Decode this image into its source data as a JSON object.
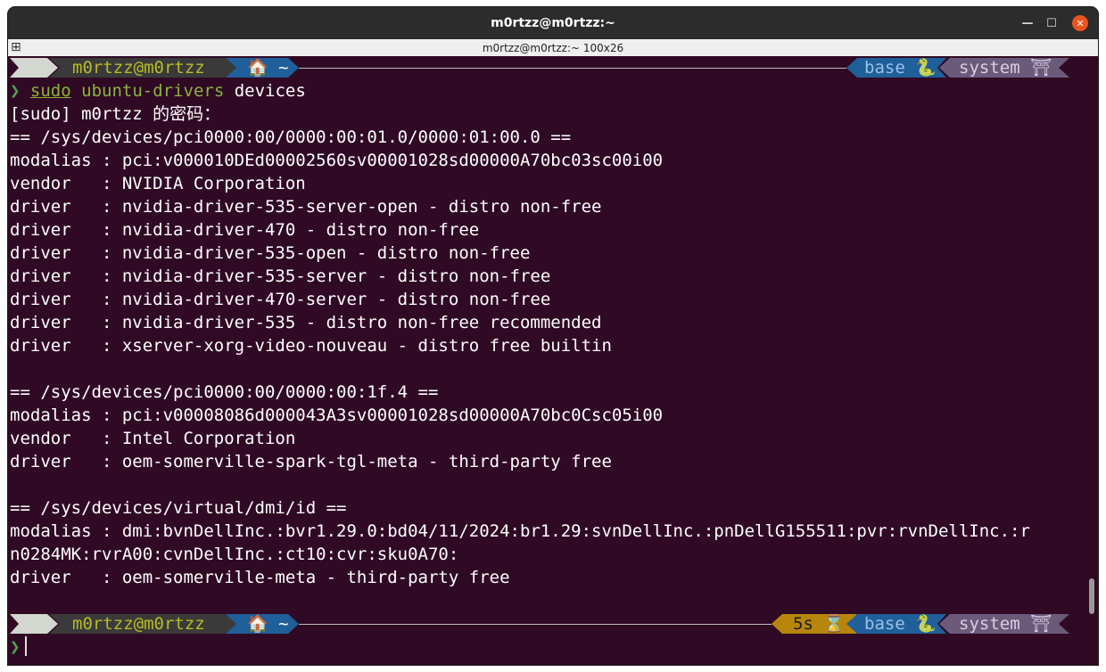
{
  "window": {
    "title": "m0rtzz@m0rtzz:~",
    "tab_title": "m0rtzz@m0rtzz:~ 100x26",
    "close_glyph": "✕",
    "min_glyph": "—",
    "max_glyph": "☐"
  },
  "prompt": {
    "os_icon": "",
    "context": "m0rtzz@m0rtzz",
    "dir": "🏠 ~",
    "time": "5s ⌛",
    "conda": "base 🐍",
    "system": "system ⛩",
    "prompt_char": "❯"
  },
  "command": {
    "sudo": "sudo",
    "tool": "ubuntu-drivers",
    "arg": "devices"
  },
  "output": [
    "[sudo] m0rtzz 的密码：",
    "== /sys/devices/pci0000:00/0000:00:01.0/0000:01:00.0 ==",
    "modalias : pci:v000010DEd00002560sv00001028sd00000A70bc03sc00i00",
    "vendor   : NVIDIA Corporation",
    "driver   : nvidia-driver-535-server-open - distro non-free",
    "driver   : nvidia-driver-470 - distro non-free",
    "driver   : nvidia-driver-535-open - distro non-free",
    "driver   : nvidia-driver-535-server - distro non-free",
    "driver   : nvidia-driver-470-server - distro non-free",
    "driver   : nvidia-driver-535 - distro non-free recommended",
    "driver   : xserver-xorg-video-nouveau - distro free builtin",
    "",
    "== /sys/devices/pci0000:00/0000:00:1f.4 ==",
    "modalias : pci:v00008086d000043A3sv00001028sd00000A70bc0Csc05i00",
    "vendor   : Intel Corporation",
    "driver   : oem-somerville-spark-tgl-meta - third-party free",
    "",
    "== /sys/devices/virtual/dmi/id ==",
    "modalias : dmi:bvnDellInc.:bvr1.29.0:bd04/11/2024:br1.29:svnDellInc.:pnDellG155511:pvr:rvnDellInc.:r",
    "n0284MK:rvrA00:cvnDellInc.:ct10:cvr:sku0A70:",
    "driver   : oem-somerville-meta - third-party free",
    ""
  ]
}
